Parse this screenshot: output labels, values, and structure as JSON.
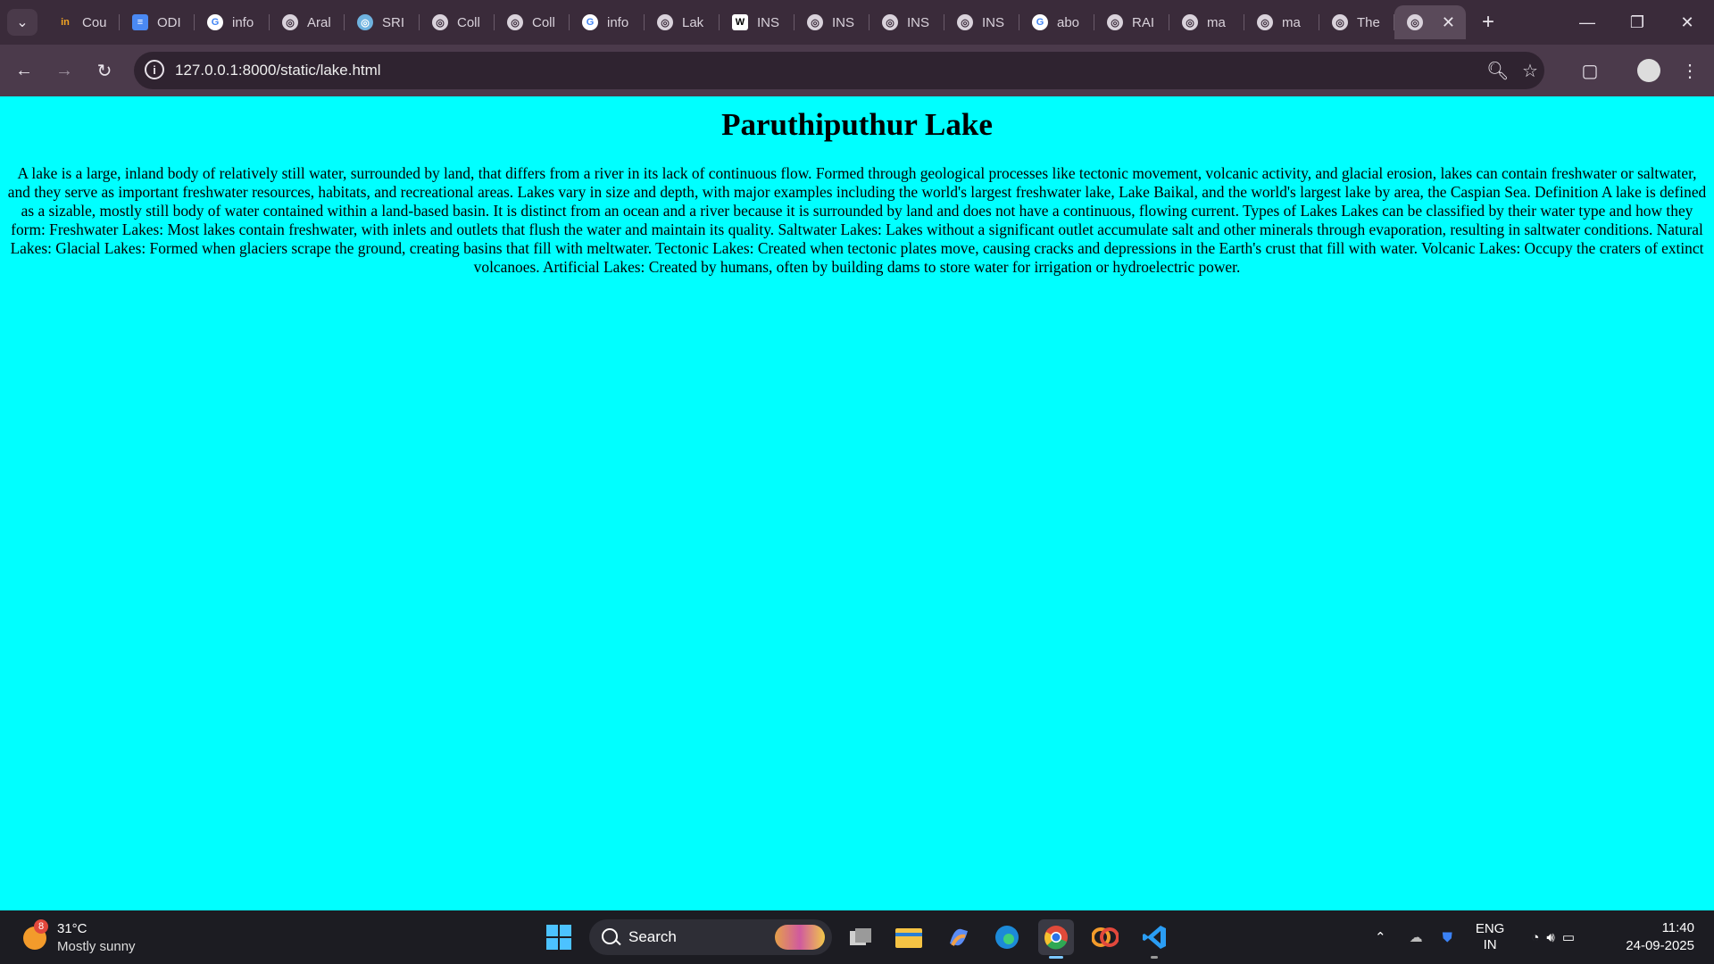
{
  "browser": {
    "tabs": [
      {
        "title": "Cou",
        "icon": "in-icon"
      },
      {
        "title": "ODI",
        "icon": "docs-icon"
      },
      {
        "title": "info",
        "icon": "google-icon"
      },
      {
        "title": "Aral",
        "icon": "globe-icon"
      },
      {
        "title": "SRI",
        "icon": "sri-icon"
      },
      {
        "title": "Coll",
        "icon": "globe-icon"
      },
      {
        "title": "Coll",
        "icon": "globe-icon"
      },
      {
        "title": "info",
        "icon": "google-icon"
      },
      {
        "title": "Lak",
        "icon": "globe-icon"
      },
      {
        "title": "INS",
        "icon": "wikipedia-icon"
      },
      {
        "title": "INS",
        "icon": "globe-icon"
      },
      {
        "title": "INS",
        "icon": "globe-icon"
      },
      {
        "title": "INS",
        "icon": "globe-icon"
      },
      {
        "title": "abo",
        "icon": "google-icon"
      },
      {
        "title": "RAI",
        "icon": "globe-icon"
      },
      {
        "title": "ma",
        "icon": "globe-icon"
      },
      {
        "title": "ma",
        "icon": "globe-icon"
      },
      {
        "title": "The",
        "icon": "globe-icon"
      },
      {
        "title": "",
        "icon": "globe-icon",
        "active": true
      }
    ],
    "url": "127.0.0.1:8000/static/lake.html"
  },
  "page": {
    "title": "Paruthiputhur Lake",
    "body": "A lake is a large, inland body of relatively still water, surrounded by land, that differs from a river in its lack of continuous flow. Formed through geological processes like tectonic movement, volcanic activity, and glacial erosion, lakes can contain freshwater or saltwater, and they serve as important freshwater resources, habitats, and recreational areas. Lakes vary in size and depth, with major examples including the world's largest freshwater lake, Lake Baikal, and the world's largest lake by area, the Caspian Sea. Definition A lake is defined as a sizable, mostly still body of water contained within a land-based basin. It is distinct from an ocean and a river because it is surrounded by land and does not have a continuous, flowing current. Types of Lakes Lakes can be classified by their water type and how they form: Freshwater Lakes: Most lakes contain freshwater, with inlets and outlets that flush the water and maintain its quality. Saltwater Lakes: Lakes without a significant outlet accumulate salt and other minerals through evaporation, resulting in saltwater conditions. Natural Lakes: Glacial Lakes: Formed when glaciers scrape the ground, creating basins that fill with meltwater. Tectonic Lakes: Created when tectonic plates move, causing cracks and depressions in the Earth's crust that fill with water. Volcanic Lakes: Occupy the craters of extinct volcanoes. Artificial Lakes: Created by humans, often by building dams to store water for irrigation or hydroelectric power.",
    "background": "#00ffff"
  },
  "taskbar": {
    "weather_badge": "8",
    "temperature": "31°C",
    "condition": "Mostly sunny",
    "search_label": "Search",
    "lang_top": "ENG",
    "lang_bottom": "IN",
    "time": "11:40",
    "date": "24-09-2025"
  }
}
